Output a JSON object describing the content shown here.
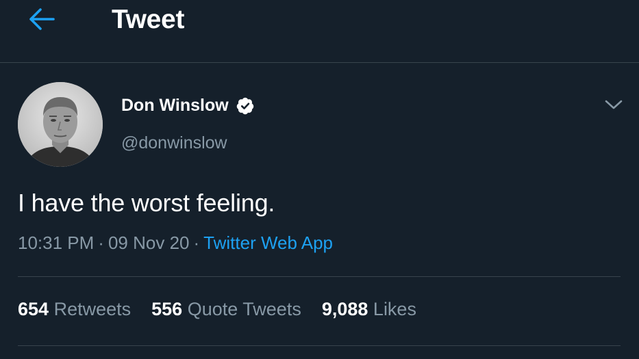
{
  "header": {
    "back_icon": "arrow-left-icon",
    "title": "Tweet"
  },
  "colors": {
    "background": "#15202b",
    "accent": "#1da1f2",
    "muted": "#8899a6",
    "divider": "#38444d"
  },
  "tweet": {
    "author": {
      "display_name": "Don Winslow",
      "handle": "@donwinslow",
      "verified_icon": "verified-badge-icon",
      "avatar_icon": "avatar-photo"
    },
    "menu_icon": "chevron-down-icon",
    "text": "I have the worst feeling.",
    "time": "10:31 PM",
    "date": "09 Nov 20",
    "separator": "·",
    "source": "Twitter Web App"
  },
  "stats": [
    {
      "count": "654",
      "label": "Retweets"
    },
    {
      "count": "556",
      "label": "Quote Tweets"
    },
    {
      "count": "9,088",
      "label": "Likes"
    }
  ]
}
